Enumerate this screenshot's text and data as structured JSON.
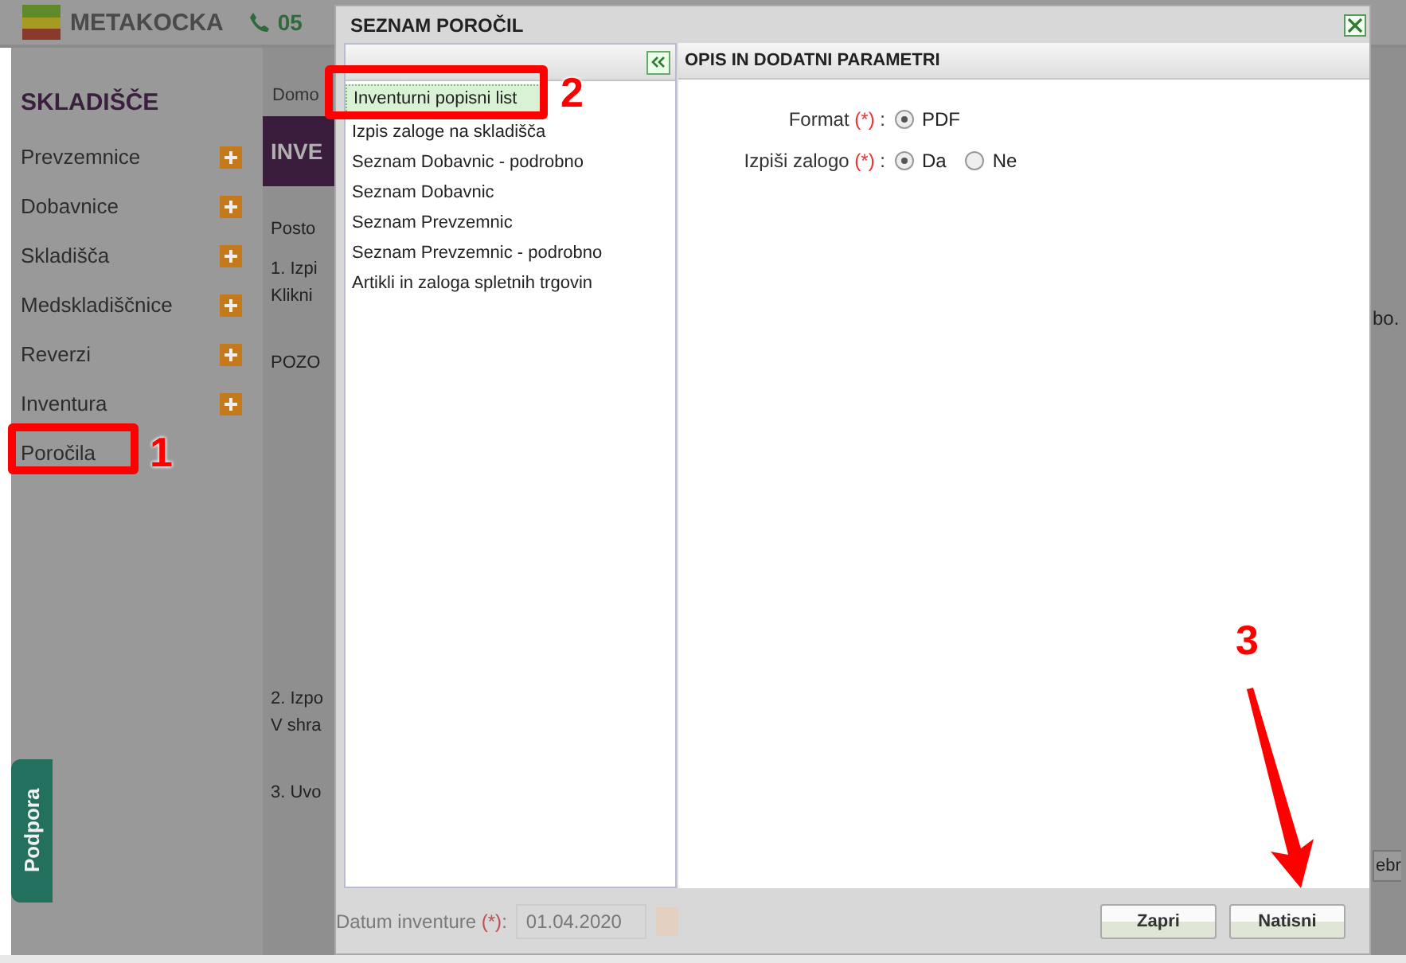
{
  "header": {
    "logo": "METAKOCKA",
    "phone": "05"
  },
  "sidebar": {
    "title": "SKLADIŠČE",
    "items": [
      {
        "label": "Prevzemnice",
        "has_add": true
      },
      {
        "label": "Dobavnice",
        "has_add": true
      },
      {
        "label": "Skladišča",
        "has_add": true
      },
      {
        "label": "Medskladiščnice",
        "has_add": true
      },
      {
        "label": "Reverzi",
        "has_add": true
      },
      {
        "label": "Inventura",
        "has_add": true
      },
      {
        "label": "Poročila",
        "has_add": false
      }
    ]
  },
  "content": {
    "breadcrumb": "Domo",
    "banner": "INVE",
    "lines": [
      "Posto",
      "1. Izpi",
      "Klikni",
      "POZO",
      "2. Izpo",
      "V shra",
      "3. Uvo"
    ],
    "right_text": "bo.",
    "right_button": "ebr",
    "date_label": "Datum inventure",
    "date_required": "(*)",
    "date_colon": ":",
    "date_value": "01.04.2020"
  },
  "support_tab": "Podpora",
  "dialog": {
    "title": "SEZNAM POROČIL",
    "reports": [
      {
        "label": "Inventurni popisni list",
        "selected": true
      },
      {
        "label": "Izpis zaloge na skladišča",
        "selected": false
      },
      {
        "label": "Seznam Dobavnic - podrobno",
        "selected": false
      },
      {
        "label": "Seznam Dobavnic",
        "selected": false
      },
      {
        "label": "Seznam Prevzemnic",
        "selected": false
      },
      {
        "label": "Seznam Prevzemnic - podrobno",
        "selected": false
      },
      {
        "label": "Artikli in zaloga spletnih trgovin",
        "selected": false
      }
    ],
    "params_title": "OPIS IN DODATNI PARAMETRI",
    "params": [
      {
        "label": "Format",
        "required": "(*)",
        "separator": ":",
        "options": [
          {
            "label": "PDF",
            "selected": true
          }
        ]
      },
      {
        "label": "Izpiši zalogo",
        "required": "(*)",
        "separator": ":",
        "options": [
          {
            "label": "Da",
            "selected": true
          },
          {
            "label": "Ne",
            "selected": false
          }
        ]
      }
    ],
    "buttons": [
      "Zapri",
      "Natisni"
    ]
  },
  "annotations": [
    {
      "number": "1"
    },
    {
      "number": "2"
    },
    {
      "number": "3"
    }
  ]
}
